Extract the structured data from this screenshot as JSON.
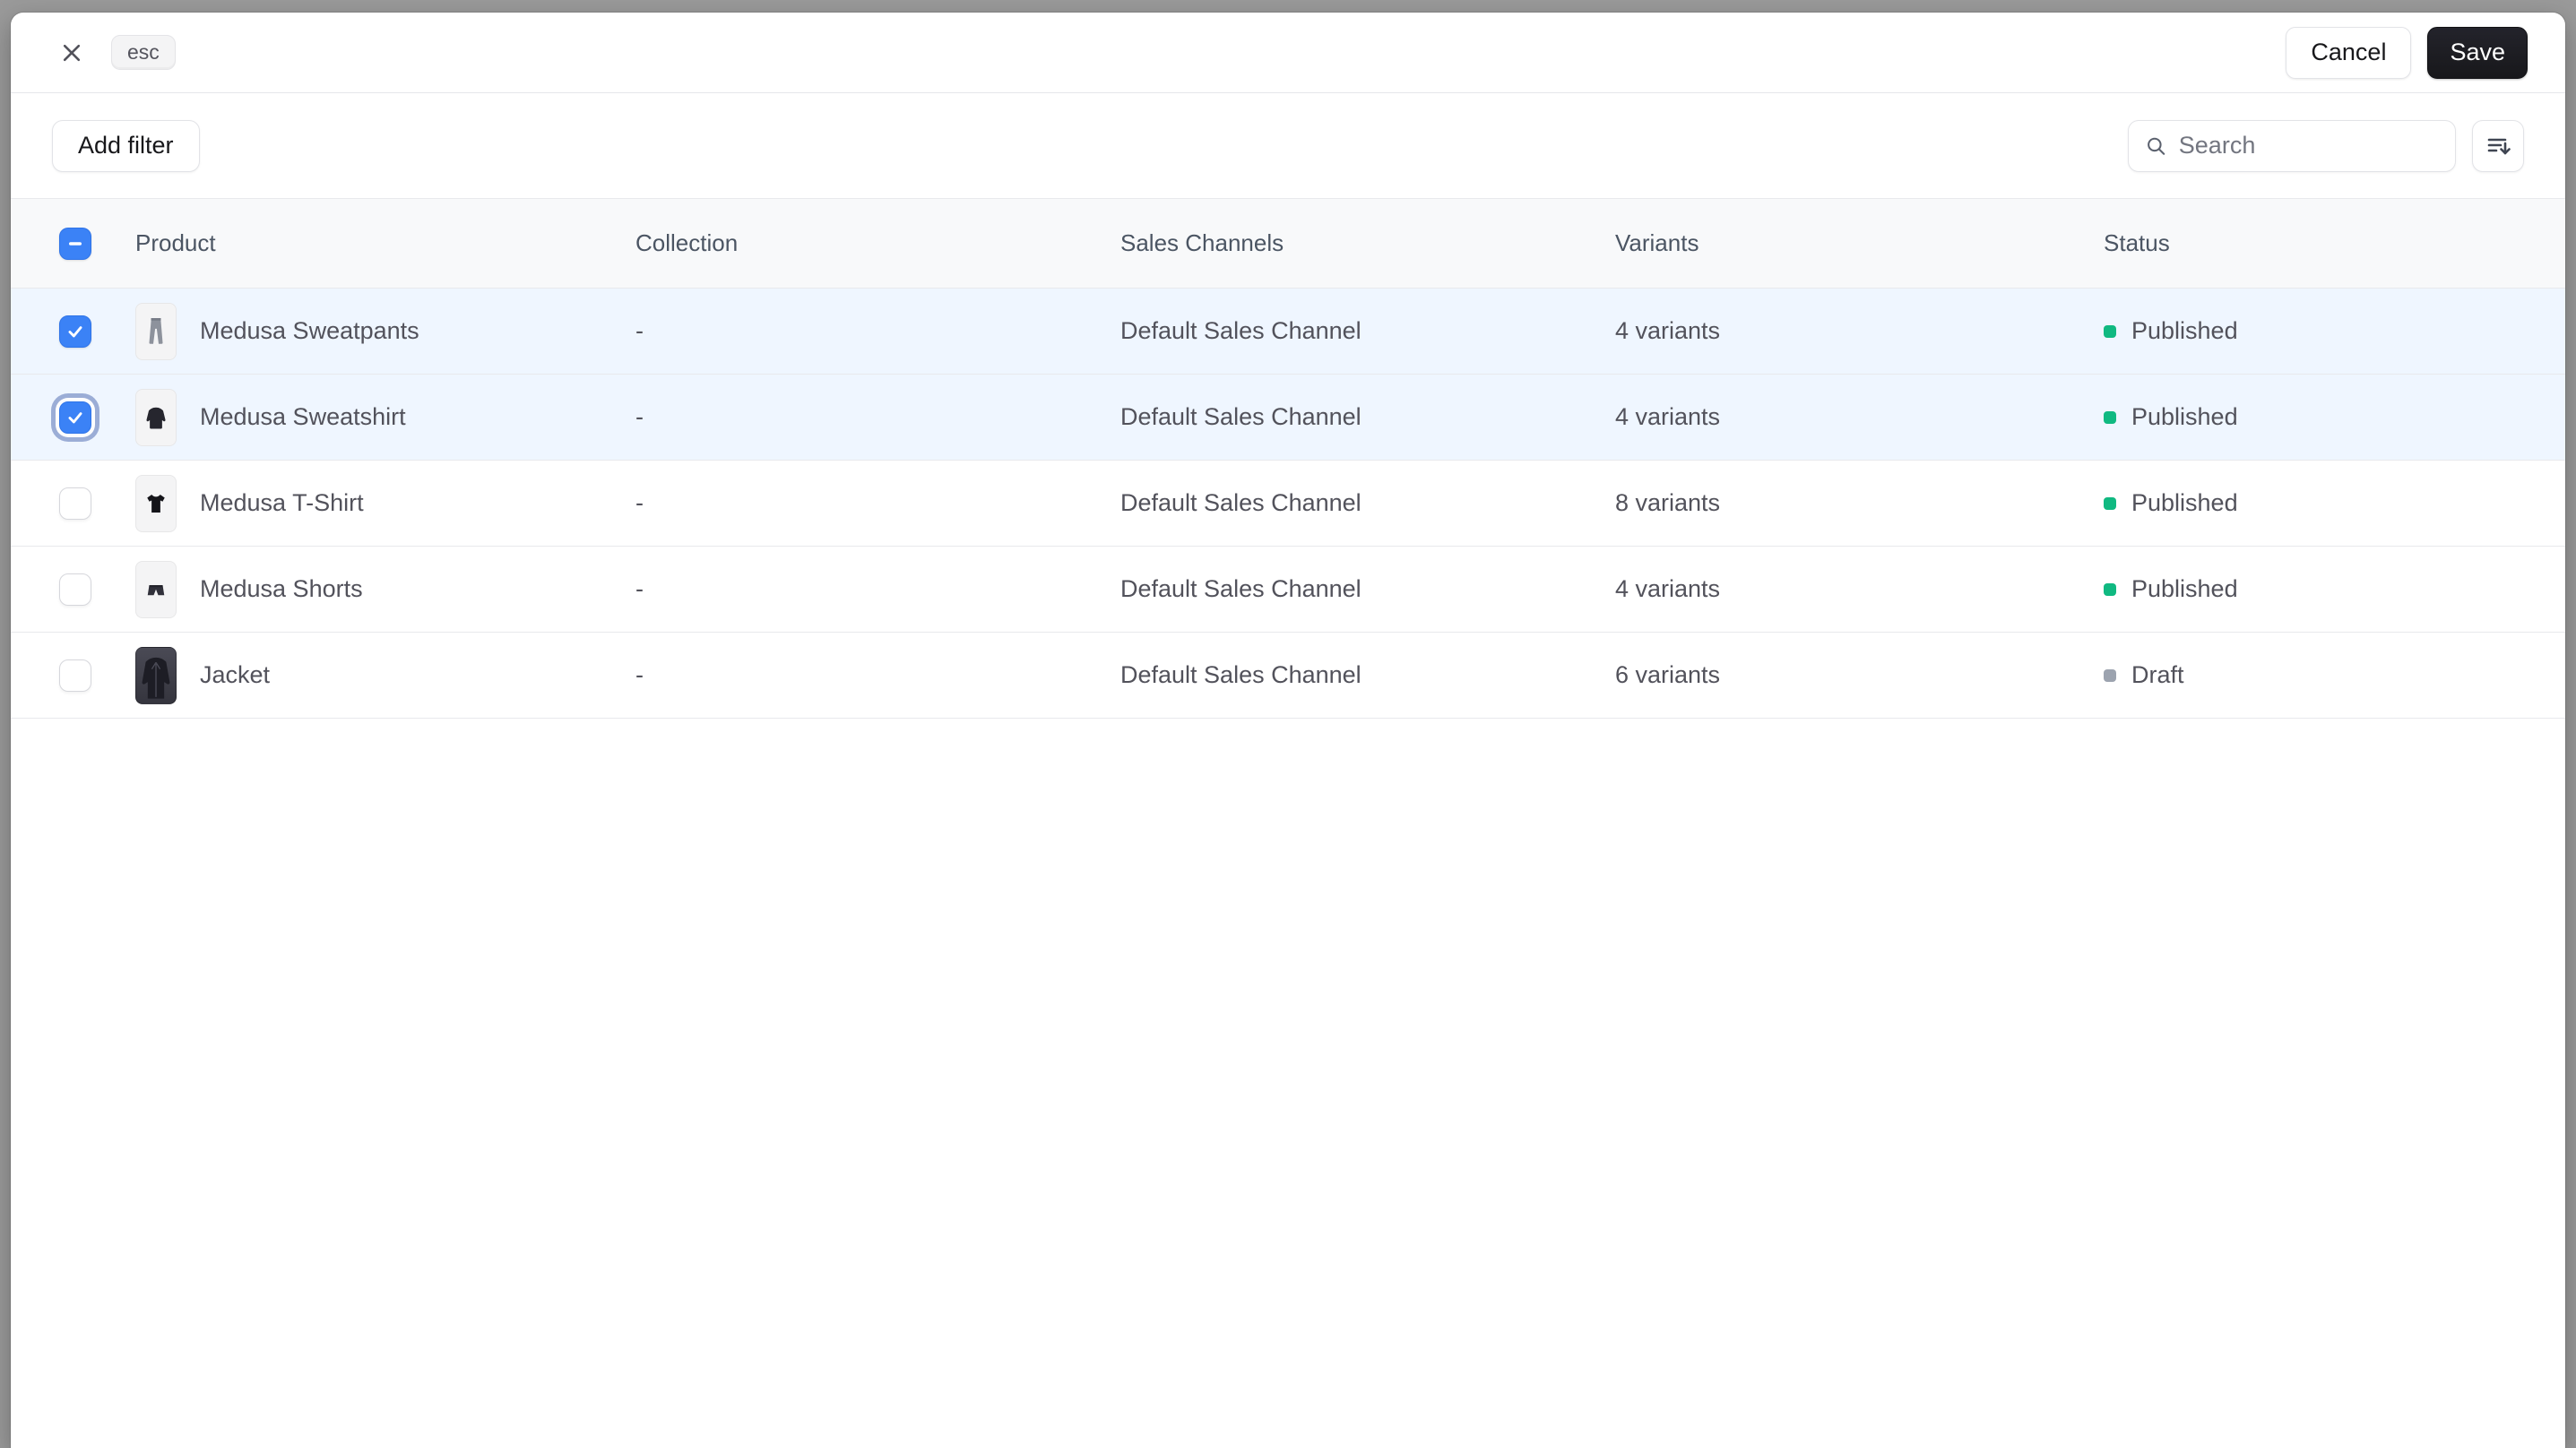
{
  "colors": {
    "backdrop": "#9a9a9a",
    "accent_blue": "#3b82f6",
    "selected_row_bg": "#eff6ff",
    "published_dot": "#10b981",
    "draft_dot": "#9ca3af",
    "save_button_bg": "#18181b"
  },
  "topbar": {
    "shortcut_badge": "esc",
    "cancel_label": "Cancel",
    "save_label": "Save"
  },
  "toolbar": {
    "add_filter_label": "Add filter",
    "search_placeholder": "Search",
    "search_value": ""
  },
  "table": {
    "select_all_state": "indeterminate",
    "headers": {
      "product": "Product",
      "collection": "Collection",
      "sales_channels": "Sales Channels",
      "variants": "Variants",
      "status": "Status"
    },
    "rows": [
      {
        "name": "Medusa Sweatpants",
        "collection": "-",
        "sales_channel": "Default Sales Channel",
        "variants": "4 variants",
        "status": "Published",
        "checked": true,
        "focused": false,
        "thumb": "sweatpants-icon"
      },
      {
        "name": "Medusa Sweatshirt",
        "collection": "-",
        "sales_channel": "Default Sales Channel",
        "variants": "4 variants",
        "status": "Published",
        "checked": true,
        "focused": true,
        "thumb": "sweatshirt-icon"
      },
      {
        "name": "Medusa T-Shirt",
        "collection": "-",
        "sales_channel": "Default Sales Channel",
        "variants": "8 variants",
        "status": "Published",
        "checked": false,
        "focused": false,
        "thumb": "tshirt-icon"
      },
      {
        "name": "Medusa Shorts",
        "collection": "-",
        "sales_channel": "Default Sales Channel",
        "variants": "4 variants",
        "status": "Published",
        "checked": false,
        "focused": false,
        "thumb": "shorts-icon"
      },
      {
        "name": "Jacket",
        "collection": "-",
        "sales_channel": "Default Sales Channel",
        "variants": "6 variants",
        "status": "Draft",
        "checked": false,
        "focused": false,
        "thumb": "jacket-icon"
      }
    ]
  }
}
